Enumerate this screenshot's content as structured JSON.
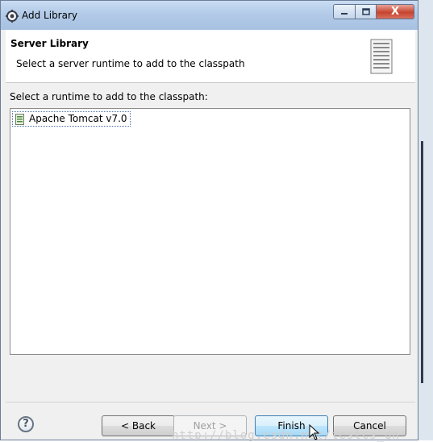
{
  "window": {
    "title": "Add Library",
    "icon": "eclipse-gear-icon",
    "close_label": "X"
  },
  "header": {
    "title": "Server Library",
    "description": "Select a server runtime to add to the classpath",
    "icon": "server-icon"
  },
  "main": {
    "prompt": "Select a runtime to add to the classpath:",
    "runtimes": [
      {
        "label": "Apache Tomcat v7.0",
        "icon": "server-runtime-icon",
        "selected": true
      }
    ]
  },
  "footer": {
    "help_symbol": "?",
    "back_label": "< Back",
    "next_label": "Next >",
    "finish_label": "Finish",
    "cancel_label": "Cancel",
    "next_enabled": false
  },
  "watermark": "http://blog.csdn.net/testcs_dn"
}
